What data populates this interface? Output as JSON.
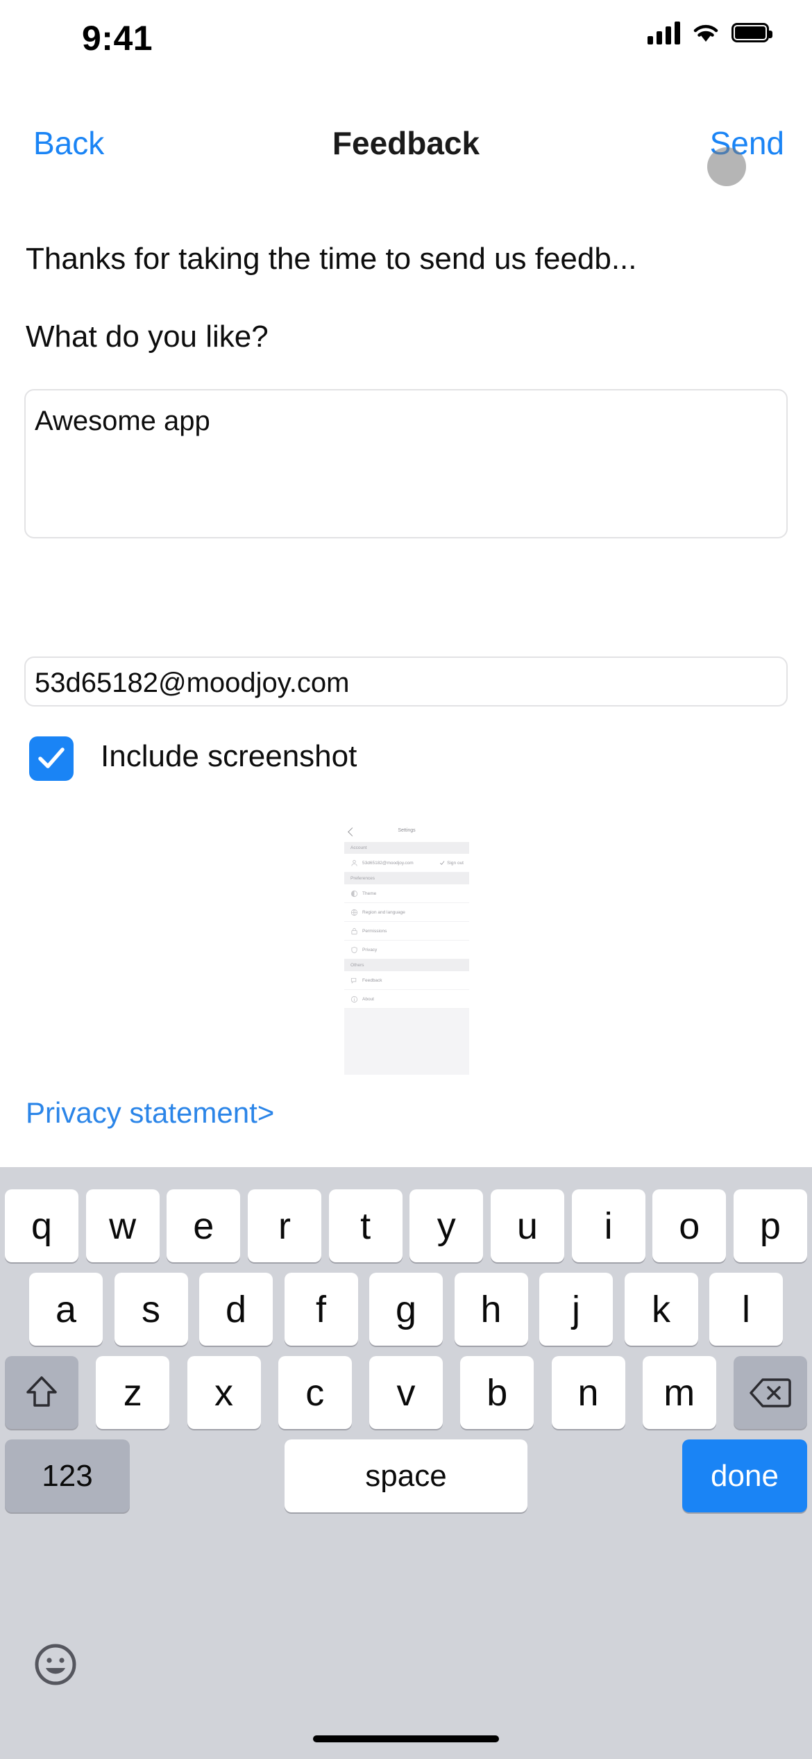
{
  "status_bar": {
    "time": "9:41",
    "signal_icon": "cellular-signal-icon",
    "wifi_icon": "wifi-icon",
    "battery_icon": "battery-full-icon"
  },
  "nav": {
    "back_label": "Back",
    "title": "Feedback",
    "send_label": "Send"
  },
  "content": {
    "intro_text": "Thanks for taking the time to send us feedb...",
    "question_label": "What do you like?",
    "feedback_value": "Awesome app",
    "feedback_placeholder": "",
    "email_value": "53d65182@moodjoy.com",
    "email_placeholder": "",
    "include_screenshot_label": "Include screenshot",
    "include_screenshot_checked": true,
    "privacy_link": "Privacy statement>"
  },
  "screenshot_preview": {
    "back_icon": "chevron-left-icon",
    "title": "Settings",
    "sections": [
      {
        "header": "Account",
        "rows": [
          {
            "icon": "person-icon",
            "label": "53d65182@moodjoy.com",
            "trailing_icon": "check-icon",
            "trailing_label": "Sign out"
          }
        ]
      },
      {
        "header": "Preferences",
        "rows": [
          {
            "icon": "theme-icon",
            "label": "Theme"
          },
          {
            "icon": "globe-icon",
            "label": "Region and language"
          },
          {
            "icon": "lock-icon",
            "label": "Permissions"
          },
          {
            "icon": "shield-icon",
            "label": "Privacy"
          }
        ]
      },
      {
        "header": "Others",
        "rows": [
          {
            "icon": "feedback-icon",
            "label": "Feedback"
          },
          {
            "icon": "info-icon",
            "label": "About"
          }
        ]
      }
    ]
  },
  "keyboard": {
    "row1": [
      "q",
      "w",
      "e",
      "r",
      "t",
      "y",
      "u",
      "i",
      "o",
      "p"
    ],
    "row2": [
      "a",
      "s",
      "d",
      "f",
      "g",
      "h",
      "j",
      "k",
      "l"
    ],
    "row3_letters": [
      "z",
      "x",
      "c",
      "v",
      "b",
      "n",
      "m"
    ],
    "shift_icon": "shift-arrow-icon",
    "backspace_icon": "backspace-delete-icon",
    "numeric_label": "123",
    "space_label": "space",
    "return_label": "done",
    "emoji_icon": "emoji-smiley-icon"
  },
  "colors": {
    "accent_blue": "#1a84f5",
    "link_blue": "#2b85e8",
    "keyboard_bg": "#d1d3d9",
    "key_bg": "#ffffff",
    "fn_key_bg": "#aeb2bd",
    "border_gray": "#e2e2e4"
  }
}
